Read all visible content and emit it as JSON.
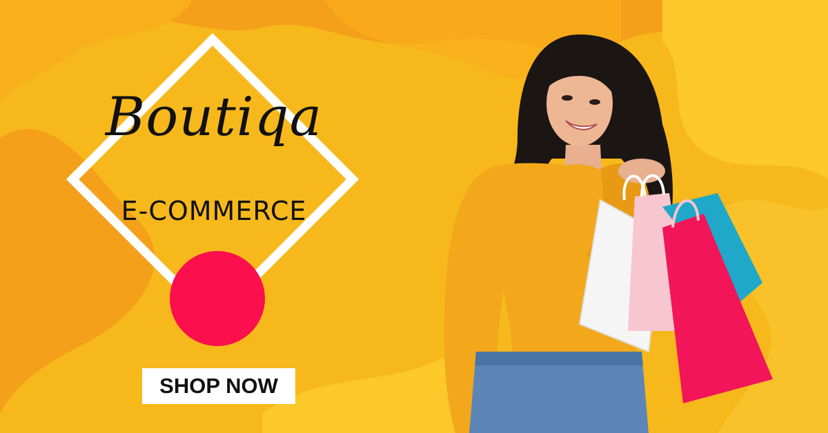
{
  "banner": {
    "brand_name": "Boutiqa",
    "tagline": "E-COMMERCE",
    "cta_label": "SHOP NOW"
  },
  "colors": {
    "background": "#f7b81c",
    "wave_dark": "#f4a01a",
    "wave_light": "#fcc82a",
    "accent_circle": "#fb0f4c",
    "frame": "#ffffff",
    "text": "#111111"
  },
  "photo": {
    "subject": "smiling woman in yellow sweater and jeans holding shopping bags"
  }
}
